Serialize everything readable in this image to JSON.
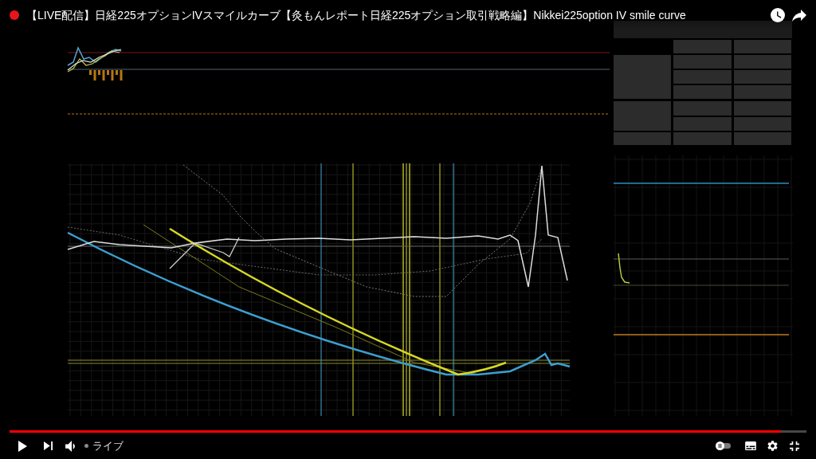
{
  "title_bar": {
    "title": "【LIVE配信】日経225オプションIVスマイルカーブ【灸もんレポート日経225オプション取引戦略編】Nikkei225option IV smile curve"
  },
  "player": {
    "progress": {
      "level": 0.968
    },
    "live": {
      "label": "ライブ",
      "at_live_edge": false
    },
    "autoplay_on": false
  }
}
